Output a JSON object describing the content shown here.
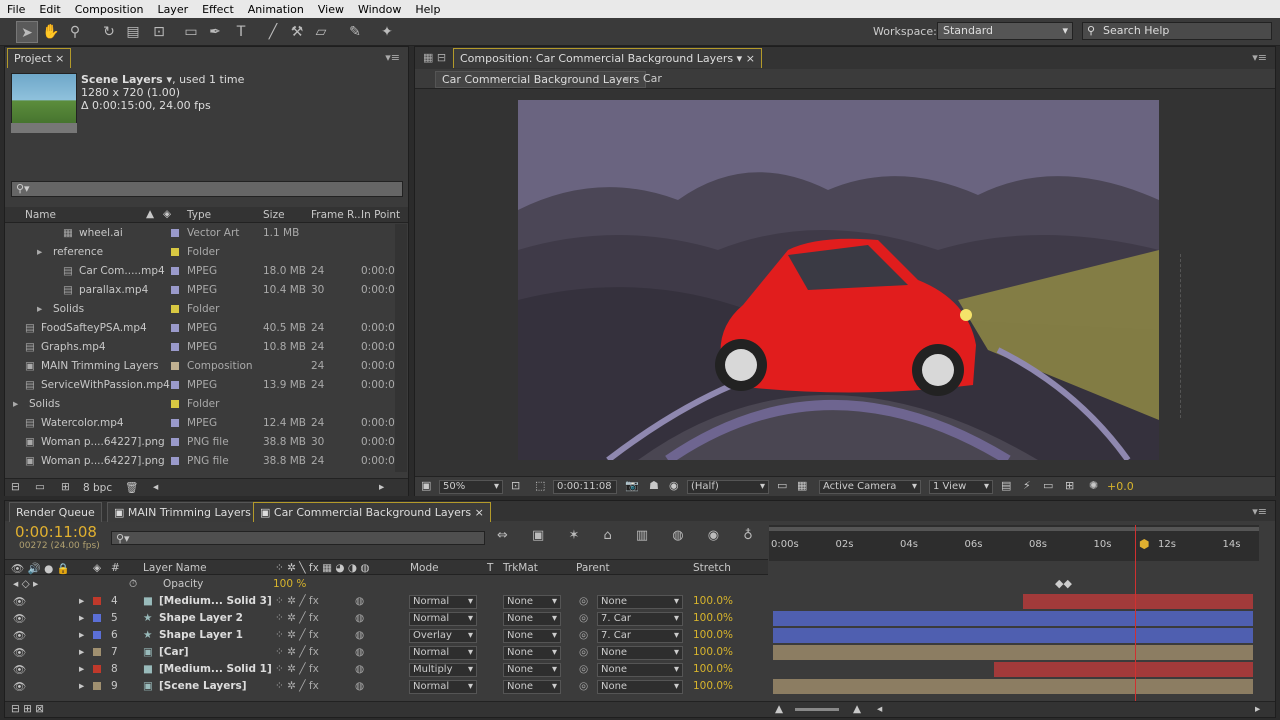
{
  "menu": [
    "File",
    "Edit",
    "Composition",
    "Layer",
    "Effect",
    "Animation",
    "View",
    "Window",
    "Help"
  ],
  "toolbar": {
    "workspace_label": "Workspace:",
    "workspace_value": "Standard",
    "search_placeholder": "Search Help"
  },
  "project": {
    "tab": "Project",
    "item_name": "Scene Layers ▾",
    "item_used": ", used 1 time",
    "item_dims": "1280 x 720 (1.00)",
    "item_dur": "Δ 0:00:15:00, 24.00 fps",
    "columns": {
      "name": "Name",
      "type": "Type",
      "size": "Size",
      "frame": "Frame R...",
      "inpoint": "In Point"
    },
    "rows": [
      {
        "name": "wheel.ai",
        "type": "Vector Art",
        "size": "1.1 MB",
        "fps": "",
        "in": "",
        "color": "#9a9acb"
      },
      {
        "name": "reference",
        "type": "Folder",
        "size": "",
        "fps": "",
        "in": "",
        "color": "#d8c842"
      },
      {
        "name": "Car Com.....mp4",
        "type": "MPEG",
        "size": "18.0 MB",
        "fps": "24",
        "in": "0:00:0",
        "color": "#9a9acb"
      },
      {
        "name": "parallax.mp4",
        "type": "MPEG",
        "size": "10.4 MB",
        "fps": "30",
        "in": "0:00:0",
        "color": "#9a9acb"
      },
      {
        "name": "Solids",
        "type": "Folder",
        "size": "",
        "fps": "",
        "in": "",
        "color": "#d8c842"
      },
      {
        "name": "FoodSafteyPSA.mp4",
        "type": "MPEG",
        "size": "40.5 MB",
        "fps": "24",
        "in": "0:00:0",
        "color": "#9a9acb"
      },
      {
        "name": "Graphs.mp4",
        "type": "MPEG",
        "size": "10.8 MB",
        "fps": "24",
        "in": "0:00:0",
        "color": "#9a9acb"
      },
      {
        "name": "MAIN Trimming Layers",
        "type": "Composition",
        "size": "",
        "fps": "24",
        "in": "0:00:0",
        "color": "#c0b090"
      },
      {
        "name": "ServiceWithPassion.mp4",
        "type": "MPEG",
        "size": "13.9 MB",
        "fps": "24",
        "in": "0:00:0",
        "color": "#9a9acb"
      },
      {
        "name": "Solids",
        "type": "Folder",
        "size": "",
        "fps": "",
        "in": "",
        "color": "#d8c842"
      },
      {
        "name": "Watercolor.mp4",
        "type": "MPEG",
        "size": "12.4 MB",
        "fps": "24",
        "in": "0:00:0",
        "color": "#9a9acb"
      },
      {
        "name": "Woman p....64227].png",
        "type": "PNG file",
        "size": "38.8 MB",
        "fps": "30",
        "in": "0:00:0",
        "color": "#9a9acb"
      },
      {
        "name": "Woman p....64227].png",
        "type": "PNG file",
        "size": "38.8 MB",
        "fps": "24",
        "in": "0:00:0",
        "color": "#9a9acb"
      }
    ],
    "bpc": "8 bpc"
  },
  "composition": {
    "tab": "Composition: Car Commercial Background Layers",
    "breadcrumb1": "Car Commercial Background Layers",
    "breadcrumb2": "Car",
    "zoom": "50%",
    "timecode": "0:00:11:08",
    "resolution": "(Half)",
    "camera": "Active Camera",
    "view": "1 View",
    "exposure": "+0.0"
  },
  "timeline": {
    "tabs": [
      "Render Queue",
      "MAIN Trimming Layers",
      "Car Commercial Background Layers"
    ],
    "timecode": "0:00:11:08",
    "frame": "00272 (24.00 fps)",
    "headers": {
      "layer_name": "Layer Name",
      "mode": "Mode",
      "t": "T",
      "trkmat": "TrkMat",
      "parent": "Parent",
      "stretch": "Stretch"
    },
    "ruler": [
      "0:00s",
      "02s",
      "04s",
      "06s",
      "08s",
      "10s",
      "12s",
      "14s"
    ],
    "opacity_label": "Opacity",
    "opacity_value": "100 %",
    "layers": [
      {
        "num": "4",
        "name": "[Medium... Solid 3]",
        "mode": "Normal",
        "trkmat": "None",
        "parent": "None",
        "stretch": "100.0%",
        "label": "#c0392b",
        "barcolor": "#a23a3a",
        "barstart": 0.52,
        "icon": "■"
      },
      {
        "num": "5",
        "name": "Shape Layer 2",
        "mode": "Normal",
        "trkmat": "None",
        "parent": "7. Car",
        "stretch": "100.0%",
        "label": "#5b6fd6",
        "barcolor": "#4f5fb0",
        "barstart": 0.0,
        "icon": "★"
      },
      {
        "num": "6",
        "name": "Shape Layer 1",
        "mode": "Overlay",
        "trkmat": "None",
        "parent": "7. Car",
        "stretch": "100.0%",
        "label": "#5b6fd6",
        "barcolor": "#4f5fb0",
        "barstart": 0.0,
        "icon": "★"
      },
      {
        "num": "7",
        "name": "[Car]",
        "mode": "Normal",
        "trkmat": "None",
        "parent": "None",
        "stretch": "100.0%",
        "label": "#a09070",
        "barcolor": "#8c7d62",
        "barstart": 0.0,
        "icon": "▣"
      },
      {
        "num": "8",
        "name": "[Medium... Solid 1]",
        "mode": "Multiply",
        "trkmat": "None",
        "parent": "None",
        "stretch": "100.0%",
        "label": "#c0392b",
        "barcolor": "#a23a3a",
        "barstart": 0.46,
        "icon": "■"
      },
      {
        "num": "9",
        "name": "[Scene Layers]",
        "mode": "Normal",
        "trkmat": "None",
        "parent": "None",
        "stretch": "100.0%",
        "label": "#a09070",
        "barcolor": "#8c7d62",
        "barstart": 0.0,
        "icon": "▣"
      }
    ]
  }
}
